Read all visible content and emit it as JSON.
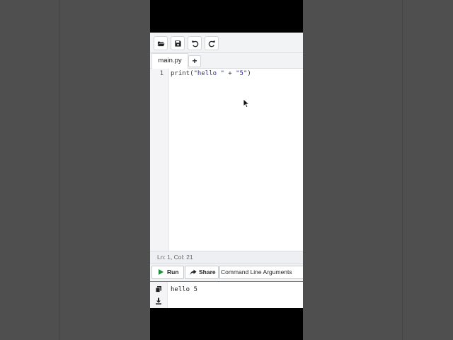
{
  "toolbar": {
    "buttons": [
      {
        "icon": "folder-open-icon"
      },
      {
        "icon": "save-icon"
      },
      {
        "icon": "undo-icon"
      },
      {
        "icon": "redo-icon"
      }
    ]
  },
  "tabs": {
    "active_label": "main.py",
    "add_label": "+"
  },
  "editor": {
    "lines": [
      {
        "number": "1",
        "code": "print(\"hello \" + \"5\")"
      }
    ],
    "tokens": {
      "func": "print(",
      "str1": "\"hello \"",
      "op": " + ",
      "str2": "\"5\"",
      "close": ")"
    }
  },
  "status": {
    "text": "Ln: 1,  Col: 21"
  },
  "runbar": {
    "run_label": "Run",
    "share_label": "Share",
    "cli_label": "Command Line Arguments"
  },
  "console": {
    "output": "hello 5",
    "side_icons": [
      "copy-icon",
      "download-icon"
    ]
  },
  "colors": {
    "run_green": "#1f8f3a",
    "accent_border": "#2e9e4b",
    "letterbox": "#000000",
    "pillar": "#4f4f4f"
  }
}
